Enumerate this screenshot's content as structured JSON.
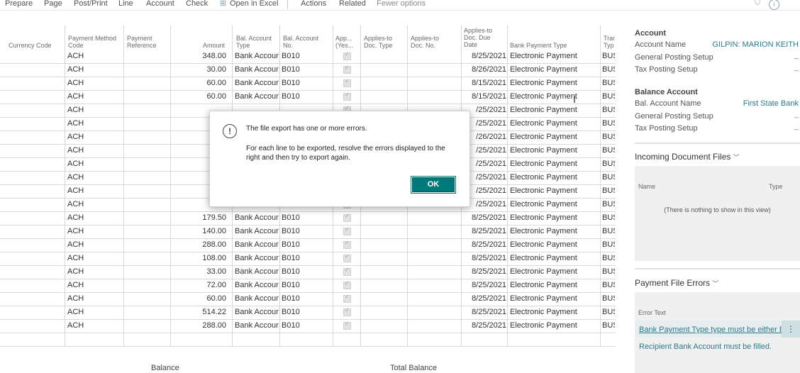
{
  "toolbar": {
    "items": [
      "Prepare",
      "Page",
      "Post/Print",
      "Line",
      "Account",
      "Check",
      "Open in Excel",
      "Actions",
      "Related",
      "Fewer options"
    ]
  },
  "columns": {
    "currency_code": "Currency Code",
    "payment_method_code": "Payment Method Code",
    "payment_reference": "Payment Reference",
    "amount": "Amount",
    "bal_account_type": "Bal. Account Type",
    "bal_account_no": "Bal. Account No.",
    "applies_yes": "App... (Yes...",
    "applies_to_doc_type": "Applies-to Doc. Type",
    "applies_to_doc_no": "Applies-to Doc. No.",
    "applies_to_due_date": "Applies-to Doc. Due Date",
    "bank_payment_type": "Bank Payment Type",
    "transaction_type": "Tran Typ"
  },
  "rows": [
    {
      "method": "ACH",
      "amount": "348.00",
      "bal_type": "Bank Account",
      "bal_no": "B010",
      "date": "8/25/2021",
      "bank_type": "Electronic Payment",
      "tran": "BUS"
    },
    {
      "method": "ACH",
      "amount": "30.00",
      "bal_type": "Bank Account",
      "bal_no": "B010",
      "date": "8/26/2021",
      "bank_type": "Electronic Payment",
      "tran": "BUS"
    },
    {
      "method": "ACH",
      "amount": "60.00",
      "bal_type": "Bank Account",
      "bal_no": "B010",
      "date": "8/15/2021",
      "bank_type": "Electronic Payment",
      "tran": "BUS"
    },
    {
      "method": "ACH",
      "amount": "60.00",
      "bal_type": "Bank Account",
      "bal_no": "B010",
      "date": "8/15/2021",
      "bank_type": "Electronic Payment",
      "tran": "BUS"
    },
    {
      "method": "ACH",
      "amount": "",
      "bal_type": "",
      "bal_no": "",
      "date": "/25/2021",
      "bank_type": "Electronic Payment",
      "tran": "BUS"
    },
    {
      "method": "ACH",
      "amount": "",
      "bal_type": "",
      "bal_no": "",
      "date": "/25/2021",
      "bank_type": "Electronic Payment",
      "tran": "BUS"
    },
    {
      "method": "ACH",
      "amount": "",
      "bal_type": "",
      "bal_no": "",
      "date": "/26/2021",
      "bank_type": "Electronic Payment",
      "tran": "BUS"
    },
    {
      "method": "ACH",
      "amount": "",
      "bal_type": "",
      "bal_no": "",
      "date": "/25/2021",
      "bank_type": "Electronic Payment",
      "tran": "BUS"
    },
    {
      "method": "ACH",
      "amount": "",
      "bal_type": "",
      "bal_no": "",
      "date": "/25/2021",
      "bank_type": "Electronic Payment",
      "tran": "BUS"
    },
    {
      "method": "ACH",
      "amount": "",
      "bal_type": "",
      "bal_no": "",
      "date": "/25/2021",
      "bank_type": "Electronic Payment",
      "tran": "BUS"
    },
    {
      "method": "ACH",
      "amount": "",
      "bal_type": "",
      "bal_no": "",
      "date": "/25/2021",
      "bank_type": "Electronic Payment",
      "tran": "BUS"
    },
    {
      "method": "ACH",
      "amount": "",
      "bal_type": "",
      "bal_no": "",
      "date": "/25/2021",
      "bank_type": "Electronic Payment",
      "tran": "BUS"
    },
    {
      "method": "ACH",
      "amount": "179.50",
      "bal_type": "Bank Account",
      "bal_no": "B010",
      "date": "8/25/2021",
      "bank_type": "Electronic Payment",
      "tran": "BUS"
    },
    {
      "method": "ACH",
      "amount": "140.00",
      "bal_type": "Bank Account",
      "bal_no": "B010",
      "date": "8/25/2021",
      "bank_type": "Electronic Payment",
      "tran": "BUS"
    },
    {
      "method": "ACH",
      "amount": "288.00",
      "bal_type": "Bank Account",
      "bal_no": "B010",
      "date": "8/25/2021",
      "bank_type": "Electronic Payment",
      "tran": "BUS"
    },
    {
      "method": "ACH",
      "amount": "108.00",
      "bal_type": "Bank Account",
      "bal_no": "B010",
      "date": "8/25/2021",
      "bank_type": "Electronic Payment",
      "tran": "BUS"
    },
    {
      "method": "ACH",
      "amount": "33.00",
      "bal_type": "Bank Account",
      "bal_no": "B010",
      "date": "8/25/2021",
      "bank_type": "Electronic Payment",
      "tran": "BUS"
    },
    {
      "method": "ACH",
      "amount": "72.00",
      "bal_type": "Bank Account",
      "bal_no": "B010",
      "date": "8/25/2021",
      "bank_type": "Electronic Payment",
      "tran": "BUS"
    },
    {
      "method": "ACH",
      "amount": "60.00",
      "bal_type": "Bank Account",
      "bal_no": "B010",
      "date": "8/25/2021",
      "bank_type": "Electronic Payment",
      "tran": "BUS"
    },
    {
      "method": "ACH",
      "amount": "514.22",
      "bal_type": "Bank Account",
      "bal_no": "B010",
      "date": "8/25/2021",
      "bank_type": "Electronic Payment",
      "tran": "BUS"
    },
    {
      "method": "ACH",
      "amount": "288.00",
      "bal_type": "Bank Account",
      "bal_no": "B010",
      "date": "8/25/2021",
      "bank_type": "Electronic Payment",
      "tran": "BUS"
    }
  ],
  "footer": {
    "balance_label": "Balance",
    "total_balance_label": "Total Balance"
  },
  "dialog": {
    "title": "The file export has one or more errors.",
    "body": "For each line to be exported, resolve the errors displayed to the right and then try to export again.",
    "ok_label": "OK"
  },
  "right_panel": {
    "account": {
      "heading": "Account",
      "account_name_label": "Account Name",
      "account_name_value": "GILPIN: MARION KEITH",
      "general_posting_label": "General Posting Setup",
      "tax_posting_label": "Tax Posting Setup",
      "dash": "_"
    },
    "balance_account": {
      "heading": "Balance Account",
      "bal_account_name_label": "Bal. Account Name",
      "bal_account_name_value": "First State Bank",
      "general_posting_label": "General Posting Setup",
      "tax_posting_label": "Tax Posting Setup"
    },
    "incoming_docs": {
      "title": "Incoming Document Files",
      "col_name": "Name",
      "col_type": "Type",
      "empty_text": "(There is nothing to show in this view)"
    },
    "payment_errors": {
      "title": "Payment File Errors",
      "col_error_text": "Error Text",
      "errors": [
        "Bank Payment Type type must be either El...",
        "Recipient Bank Account must be filled."
      ]
    }
  },
  "colors": {
    "accent": "#00797a",
    "link": "#2a7a8c"
  }
}
